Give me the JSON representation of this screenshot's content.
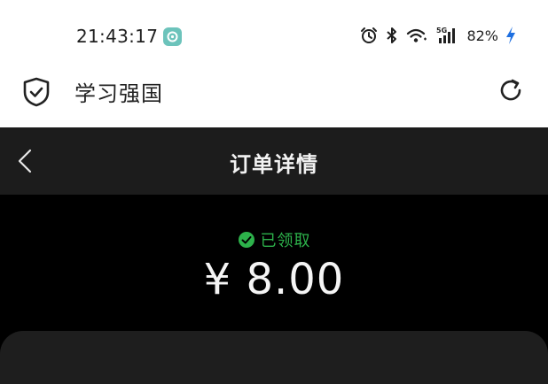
{
  "status_bar": {
    "time": "21:43:17",
    "battery": "82%",
    "network": "5G"
  },
  "app_bar": {
    "title": "学习强国"
  },
  "nav": {
    "title": "订单详情"
  },
  "order": {
    "status": "已领取",
    "amount": "¥ 8.00"
  },
  "colors": {
    "status_green": "#2db24b",
    "nav_bg": "#1c1c1c",
    "content_bg": "#000000",
    "card_bg": "#1e1e1e"
  }
}
